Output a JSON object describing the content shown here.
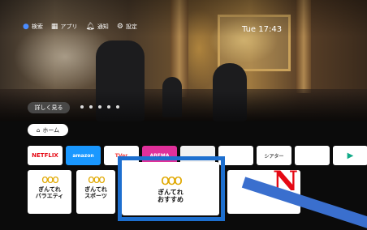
{
  "topbar": {
    "search_label": "検索",
    "apps_label": "アプリ",
    "notifications_label": "通知",
    "settings_label": "設定"
  },
  "clock": "Tue 17:43",
  "hero": {
    "more_button_label": "詳しく見る",
    "dot_count": 5
  },
  "nav": {
    "home_label": "ホーム"
  },
  "apps": [
    {
      "name": "netflix",
      "label": "NETFLIX"
    },
    {
      "name": "prime-video",
      "label": "amazon"
    },
    {
      "name": "tver",
      "label": "TVer"
    },
    {
      "name": "abema",
      "label": "ABEMA"
    },
    {
      "name": "app-5",
      "label": ""
    },
    {
      "name": "app-6",
      "label": ""
    },
    {
      "name": "app-7",
      "label": "シアター"
    },
    {
      "name": "app-8",
      "label": ""
    },
    {
      "name": "google-play",
      "label": ""
    }
  ],
  "cards": {
    "logo": "ooo",
    "card1_line1": "ぎんてれ",
    "card1_line2": "バラエティ",
    "card2_line1": "ぎんてれ",
    "card2_line2": "スポーツ",
    "card3_line1": "ぎんてれ",
    "card3_line2": "おすすめ",
    "card4_letter": "N"
  },
  "colors": {
    "focus_border": "#1d6fcf",
    "arrow": "#3a6fce",
    "netflix_red": "#e50914"
  }
}
